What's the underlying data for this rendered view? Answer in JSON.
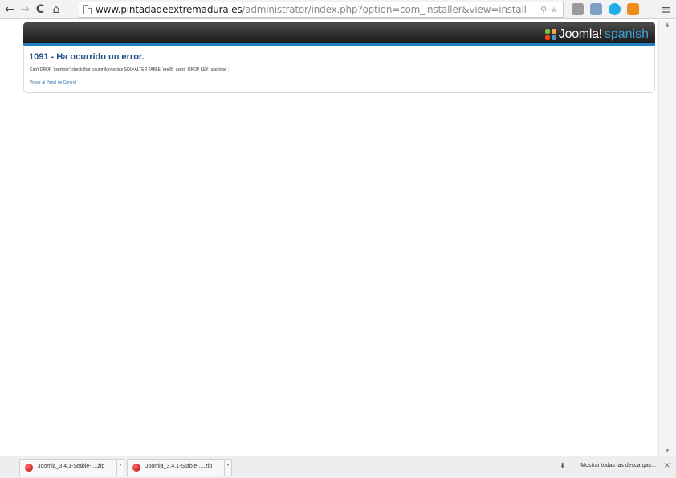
{
  "browser": {
    "back_icon": "←",
    "forward_icon": "→",
    "reload_icon": "C",
    "home_icon": "⌂",
    "url_host": "www.pintadadeextremadura.es",
    "url_path": "/administrator/index.php?option=com_installer&view=install",
    "search_icon": "⚲",
    "star_icon": "★",
    "menu_icon": "≡"
  },
  "header": {
    "brand": "Joomla!",
    "brand_sub": "spanish"
  },
  "error": {
    "title": "1091 - Ha ocurrido un error.",
    "message": "Can't DROP 'usertype'; check that column/key exists SQL=ALTER TABLE `ere2b_users` DROP KEY `usertype`;",
    "link": "Volver al Panel de Control"
  },
  "downloads": {
    "items": [
      {
        "name": "Joomla_3.4.1-Stable-....zip"
      },
      {
        "name": "Joomla_3.4.1-Stable-....zip"
      }
    ],
    "show_all": "Mostrar todas las descargas...",
    "close_icon": "×"
  },
  "colors": {
    "accent": "#1e7fc4",
    "title": "#1f4e87",
    "link": "#2668ab"
  }
}
